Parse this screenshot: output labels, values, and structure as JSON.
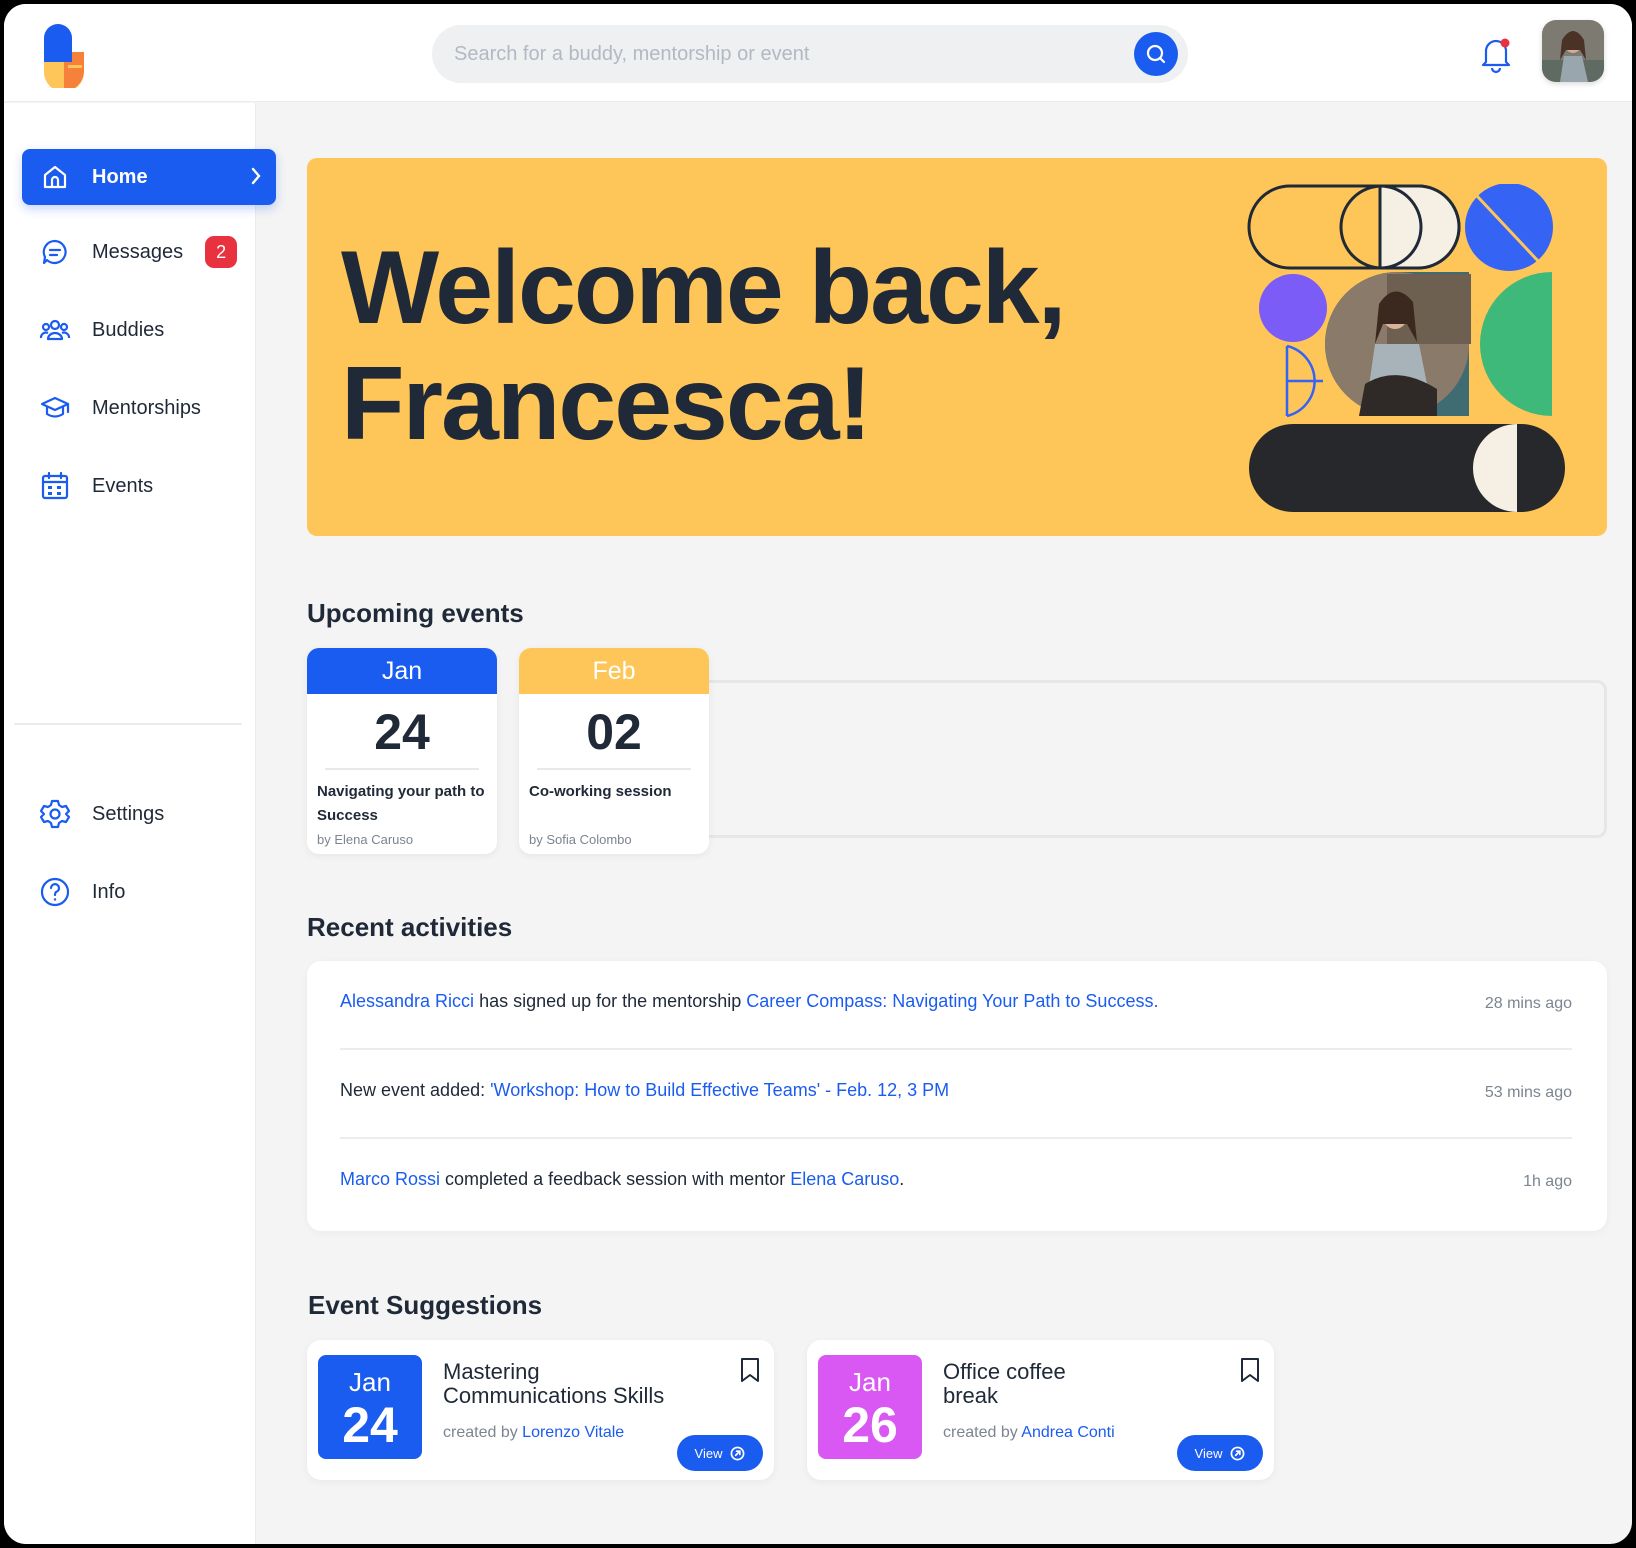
{
  "search": {
    "placeholder": "Search for a buddy, mentorship or event"
  },
  "sidebar": {
    "items": [
      {
        "label": "Home",
        "icon": "home-icon",
        "active": true
      },
      {
        "label": "Messages",
        "icon": "message-icon",
        "badge": "2"
      },
      {
        "label": "Buddies",
        "icon": "users-icon"
      },
      {
        "label": "Mentorships",
        "icon": "graduation-cap-icon"
      },
      {
        "label": "Events",
        "icon": "calendar-icon"
      }
    ],
    "bottom_items": [
      {
        "label": "Settings",
        "icon": "gear-icon"
      },
      {
        "label": "Info",
        "icon": "question-icon"
      }
    ]
  },
  "hero": {
    "line1": "Welcome back,",
    "line2": "Francesca!"
  },
  "upcoming": {
    "title": "Upcoming events",
    "events": [
      {
        "month": "Jan",
        "day": "24",
        "title": "Navigating your path to Success",
        "by": "by Elena Caruso",
        "color": "#1a5cf0"
      },
      {
        "month": "Feb",
        "day": "02",
        "title": "Co-working session",
        "by": "by Sofia Colombo",
        "color": "#fec558"
      }
    ]
  },
  "activities": {
    "title": "Recent activities",
    "rows": [
      {
        "a": "Alessandra Ricci",
        "b": " has signed up for the mentorship ",
        "c": "Career Compass: Navigating Your Path to Success.",
        "d": "",
        "e": "",
        "time": "28 mins ago"
      },
      {
        "a": "",
        "b": "New event added: ",
        "c": "'Workshop: How to Build Effective Teams' - Feb. 12, 3 PM",
        "d": "",
        "e": "",
        "time": "53 mins ago"
      },
      {
        "a": "Marco Rossi",
        "b": " completed a feedback session with mentor ",
        "c": "Elena Caruso",
        "d": ".",
        "e": "",
        "time": "1h ago"
      }
    ]
  },
  "suggestions": {
    "title": "Event Suggestions",
    "items": [
      {
        "month": "Jan",
        "day": "24",
        "title": "Mastering Communications Skills",
        "created_by": "created by",
        "author": "Lorenzo Vitale",
        "view": "View",
        "color": "#1a5cf0"
      },
      {
        "month": "Jan",
        "day": "26",
        "title": "Office coffee break",
        "created_by": "created by",
        "author": "Andrea Conti",
        "view": "View",
        "color": "#d957f2"
      }
    ]
  },
  "colors": {
    "accent": "#1a5cf0",
    "hero_bg": "#fec558",
    "badge": "#e8323f"
  }
}
